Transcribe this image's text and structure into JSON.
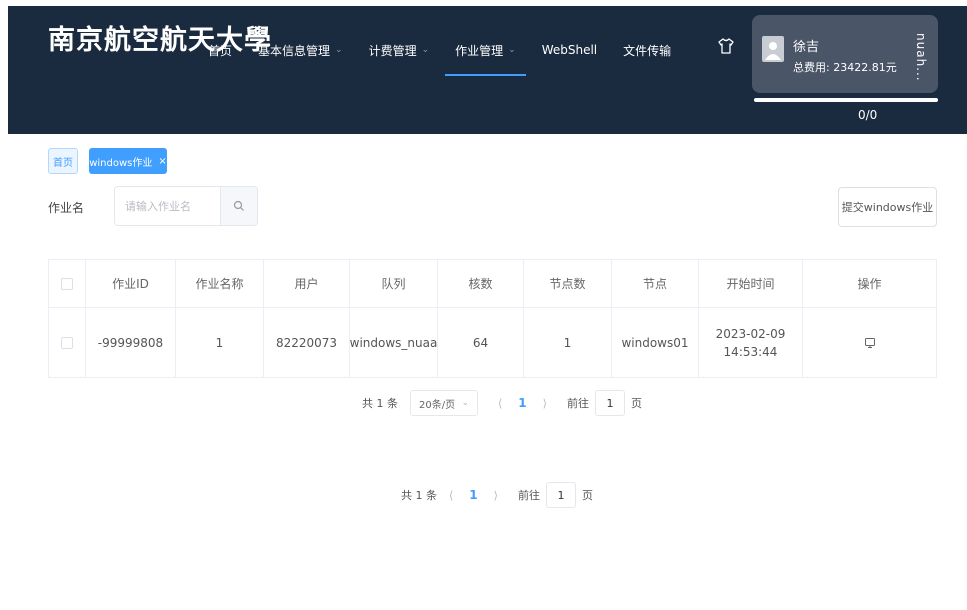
{
  "header": {
    "logo_text": "南京航空航天大學",
    "nav": [
      {
        "label": "首页",
        "has_dropdown": false,
        "active": false
      },
      {
        "label": "基本信息管理",
        "has_dropdown": true,
        "active": false
      },
      {
        "label": "计费管理",
        "has_dropdown": true,
        "active": false
      },
      {
        "label": "作业管理",
        "has_dropdown": true,
        "active": true
      },
      {
        "label": "WebShell",
        "has_dropdown": false,
        "active": false
      },
      {
        "label": "文件传输",
        "has_dropdown": false,
        "active": false
      }
    ],
    "user": {
      "name": "徐吉",
      "fee_label": "总费用:",
      "fee_value": "23422.81元",
      "side_text": "nuah...",
      "progress_text": "0/0",
      "progress_fraction": 0
    },
    "colors": {
      "header_bg": "#1a2a3f",
      "accent": "#409eff",
      "card_bg": "#4a5668"
    }
  },
  "tags": {
    "home": "首页",
    "active": "windows作业",
    "close": "×"
  },
  "search": {
    "label": "作业名",
    "placeholder": "请输入作业名",
    "submit_label": "提交windows作业"
  },
  "table": {
    "columns": [
      "作业ID",
      "作业名称",
      "用户",
      "队列",
      "核数",
      "节点数",
      "节点",
      "开始时间",
      "操作"
    ],
    "rows": [
      {
        "id": "-99999808",
        "name": "1",
        "user": "82220073",
        "queue": "windows_nuaa",
        "cores": "64",
        "nodes": "1",
        "node": "windows01",
        "start": "2023-02-09 14:53:44",
        "action_icon": "monitor-icon"
      }
    ]
  },
  "pagination_top": {
    "total": "共 1 条",
    "page_size": "20条/页",
    "current": "1",
    "goto_label": "前往",
    "goto_value": "1",
    "page_unit": "页"
  },
  "pagination_bottom": {
    "total": "共 1 条",
    "current": "1",
    "goto_label": "前往",
    "goto_value": "1",
    "page_unit": "页"
  }
}
